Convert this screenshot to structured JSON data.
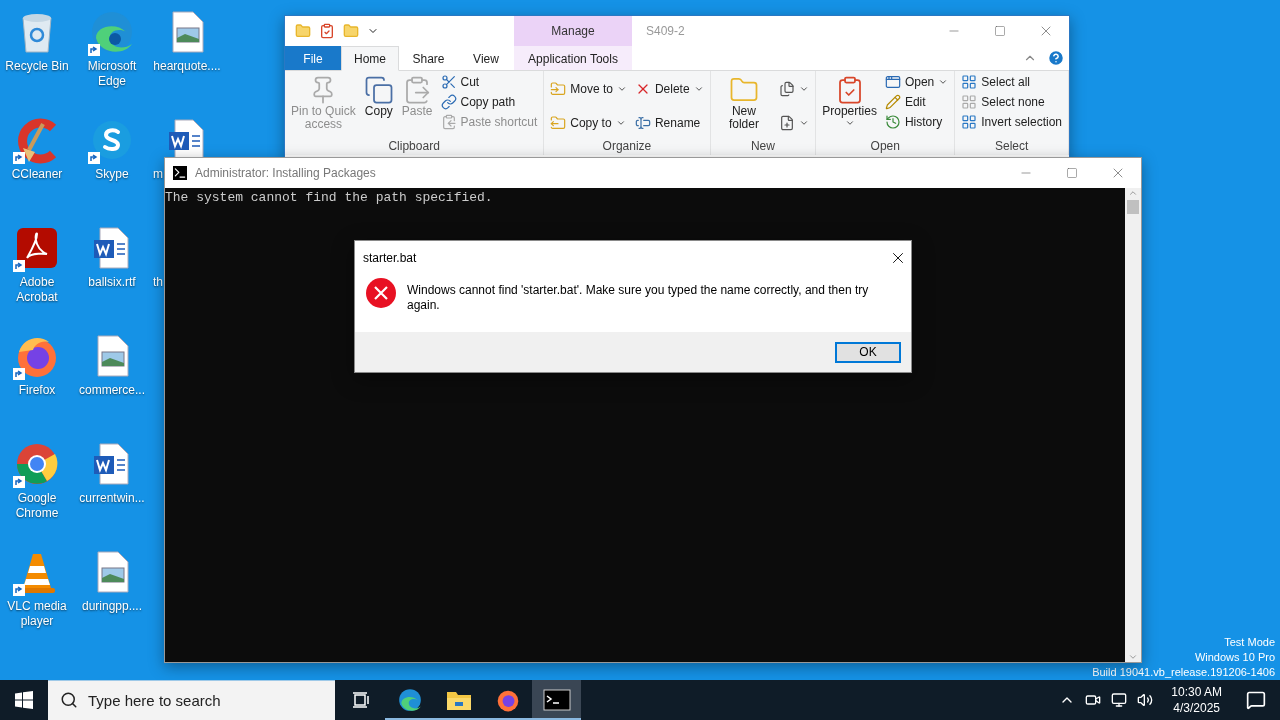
{
  "desktop_icons": [
    {
      "label": "Recycle Bin",
      "shortcut": false
    },
    {
      "label": "CCleaner",
      "shortcut": true
    },
    {
      "label": "Adobe Acrobat",
      "shortcut": true
    },
    {
      "label": "Firefox",
      "shortcut": true
    },
    {
      "label": "Google Chrome",
      "shortcut": true
    },
    {
      "label": "VLC media player",
      "shortcut": true
    },
    {
      "label": "Microsoft Edge",
      "shortcut": true
    },
    {
      "label": "Skype",
      "shortcut": true
    },
    {
      "label": "ballsix.rtf",
      "shortcut": false
    },
    {
      "label": "commerce...",
      "shortcut": false
    },
    {
      "label": "currentwin...",
      "shortcut": false
    },
    {
      "label": "duringpp....",
      "shortcut": false
    },
    {
      "label": "hearquote....",
      "shortcut": false
    },
    {
      "label": "m",
      "shortcut": false,
      "partially_covered": true
    },
    {
      "label": "th",
      "shortcut": false,
      "partially_covered": true
    }
  ],
  "explorer": {
    "title": "S409-2",
    "context_tab": "Manage",
    "tabs": [
      {
        "label": "File",
        "kind": "file",
        "selected": false
      },
      {
        "label": "Home",
        "kind": "tab",
        "selected": true
      },
      {
        "label": "Share",
        "kind": "tab",
        "selected": false
      },
      {
        "label": "View",
        "kind": "tab",
        "selected": false
      },
      {
        "label": "Application Tools",
        "kind": "context",
        "selected": false
      }
    ],
    "groups": [
      {
        "label": "Clipboard",
        "columns": [
          [
            {
              "kind": "large",
              "label": "Pin to Quick access",
              "disabled": true,
              "dropdown": false
            }
          ],
          [
            {
              "kind": "large",
              "label": "Copy",
              "disabled": false,
              "dropdown": false
            }
          ],
          [
            {
              "kind": "large",
              "label": "Paste",
              "disabled": true,
              "dropdown": false
            }
          ],
          [
            {
              "kind": "small",
              "label": "Cut",
              "disabled": false,
              "dropdown": false
            },
            {
              "kind": "small",
              "label": "Copy path",
              "disabled": false,
              "dropdown": false
            },
            {
              "kind": "small",
              "label": "Paste shortcut",
              "disabled": true,
              "dropdown": false
            }
          ]
        ]
      },
      {
        "label": "Organize",
        "columns": [
          [
            {
              "kind": "small",
              "label": "Move to",
              "disabled": false,
              "dropdown": true
            },
            {
              "kind": "small",
              "label": "Copy to",
              "disabled": false,
              "dropdown": true
            }
          ],
          [
            {
              "kind": "small",
              "label": "Delete",
              "disabled": false,
              "dropdown": true
            },
            {
              "kind": "small",
              "label": "Rename",
              "disabled": false,
              "dropdown": false
            }
          ]
        ]
      },
      {
        "label": "New",
        "columns": [
          [
            {
              "kind": "large",
              "label": "New folder",
              "disabled": false,
              "dropdown": false
            }
          ],
          [
            {
              "kind": "icon",
              "disabled": false,
              "dropdown": true
            },
            {
              "kind": "icon",
              "disabled": false,
              "dropdown": true
            }
          ]
        ]
      },
      {
        "label": "Open",
        "columns": [
          [
            {
              "kind": "large",
              "label": "Properties",
              "disabled": false,
              "dropdown": true
            }
          ],
          [
            {
              "kind": "small",
              "label": "Open",
              "disabled": false,
              "dropdown": true
            },
            {
              "kind": "small",
              "label": "Edit",
              "disabled": false,
              "dropdown": false
            },
            {
              "kind": "small",
              "label": "History",
              "disabled": false,
              "dropdown": false
            }
          ]
        ]
      },
      {
        "label": "Select",
        "columns": [
          [
            {
              "kind": "small",
              "label": "Select all",
              "disabled": false,
              "dropdown": false
            },
            {
              "kind": "small",
              "label": "Select none",
              "disabled": false,
              "dropdown": false
            },
            {
              "kind": "small",
              "label": "Invert selection",
              "disabled": false,
              "dropdown": false
            }
          ]
        ]
      }
    ]
  },
  "console": {
    "title": "Administrator:  Installing Packages",
    "output": "The system cannot find the path specified."
  },
  "dialog": {
    "title": "starter.bat",
    "message": "Windows cannot find 'starter.bat'. Make sure you typed the name correctly, and then try again.",
    "button": "OK"
  },
  "system_notice": [
    "Test Mode",
    "Windows 10 Pro",
    "Build 19041.vb_release.191206-1406"
  ],
  "taskbar": {
    "search": {
      "placeholder": "Type here to search"
    },
    "apps": [
      {
        "kind": "taskview",
        "running": false,
        "selected": false
      },
      {
        "kind": "edge",
        "running": true,
        "selected": false
      },
      {
        "kind": "explorer",
        "running": true,
        "selected": false
      },
      {
        "kind": "firefox",
        "running": true,
        "selected": false
      },
      {
        "kind": "console",
        "running": true,
        "selected": true
      }
    ],
    "time": "10:30 AM",
    "date": "4/3/2025"
  }
}
